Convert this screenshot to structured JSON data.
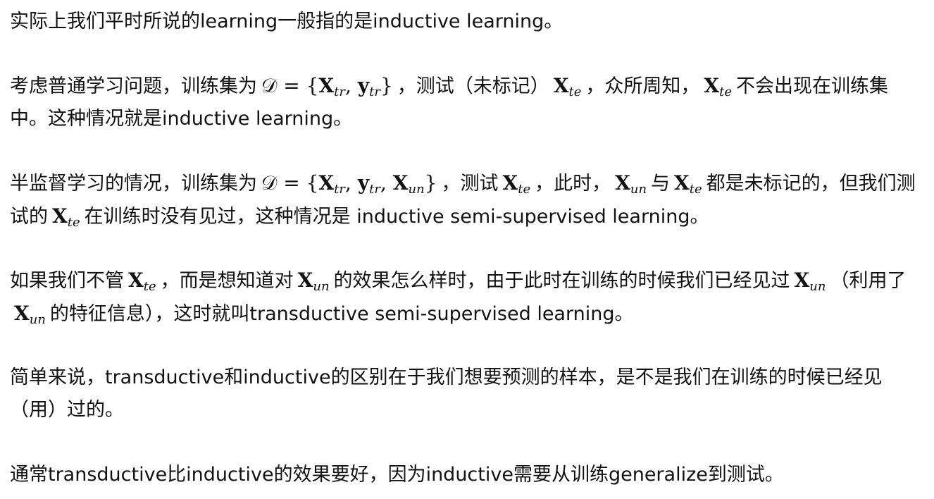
{
  "paragraphs": {
    "p1": {
      "text": "实际上我们平时所说的learning一般指的是inductive learning。"
    },
    "p2": {
      "a": "考虑普通学习问题，训练集为",
      "math_D": "𝒟 = {",
      "X": "X",
      "tr1": "tr",
      "comma": ", ",
      "y": "y",
      "tr2": "tr",
      "close": "}",
      "b": "，测试（未标记）",
      "X_te": "X",
      "te1": "te",
      "c": "，众所周知，",
      "X_te2": "X",
      "te2": "te",
      "d": "不会出现在训练集中。这种情况就是inductive learning。"
    },
    "p3": {
      "a": "半监督学习的情况，训练集为",
      "math_D": "𝒟 = {",
      "X": "X",
      "tr1": "tr",
      "y": "y",
      "tr2": "tr",
      "Xun": "X",
      "un1": "un",
      "close": "}",
      "b": "，测试",
      "X_te": "X",
      "te1": "te",
      "c": "，此时，",
      "X_un2": "X",
      "un2": "un",
      "d": "与",
      "X_te2": "X",
      "te2": "te",
      "e": "都是未标记的，但我们测试的",
      "X_te3": "X",
      "te3": "te",
      "f": "在训练时没有见过，这种情况是 inductive semi-supervised learning。"
    },
    "p4": {
      "a": "如果我们不管",
      "X_te": "X",
      "te1": "te",
      "b": "，而是想知道对",
      "X_un": "X",
      "un1": "un",
      "c": "的效果怎么样时，由于此时在训练的时候我们已经见过",
      "X_un2": "X",
      "un2": "un",
      "d": "（利用了",
      "X_un3": "X",
      "un3": "un",
      "e": "的特征信息），这时就叫transductive semi-supervised learning。"
    },
    "p5": {
      "text": "简单来说，transductive和inductive的区别在于我们想要预测的样本，是不是我们在训练的时候已经见（用）过的。"
    },
    "p6": {
      "text": "通常transductive比inductive的效果要好，因为inductive需要从训练generalize到测试。"
    }
  }
}
